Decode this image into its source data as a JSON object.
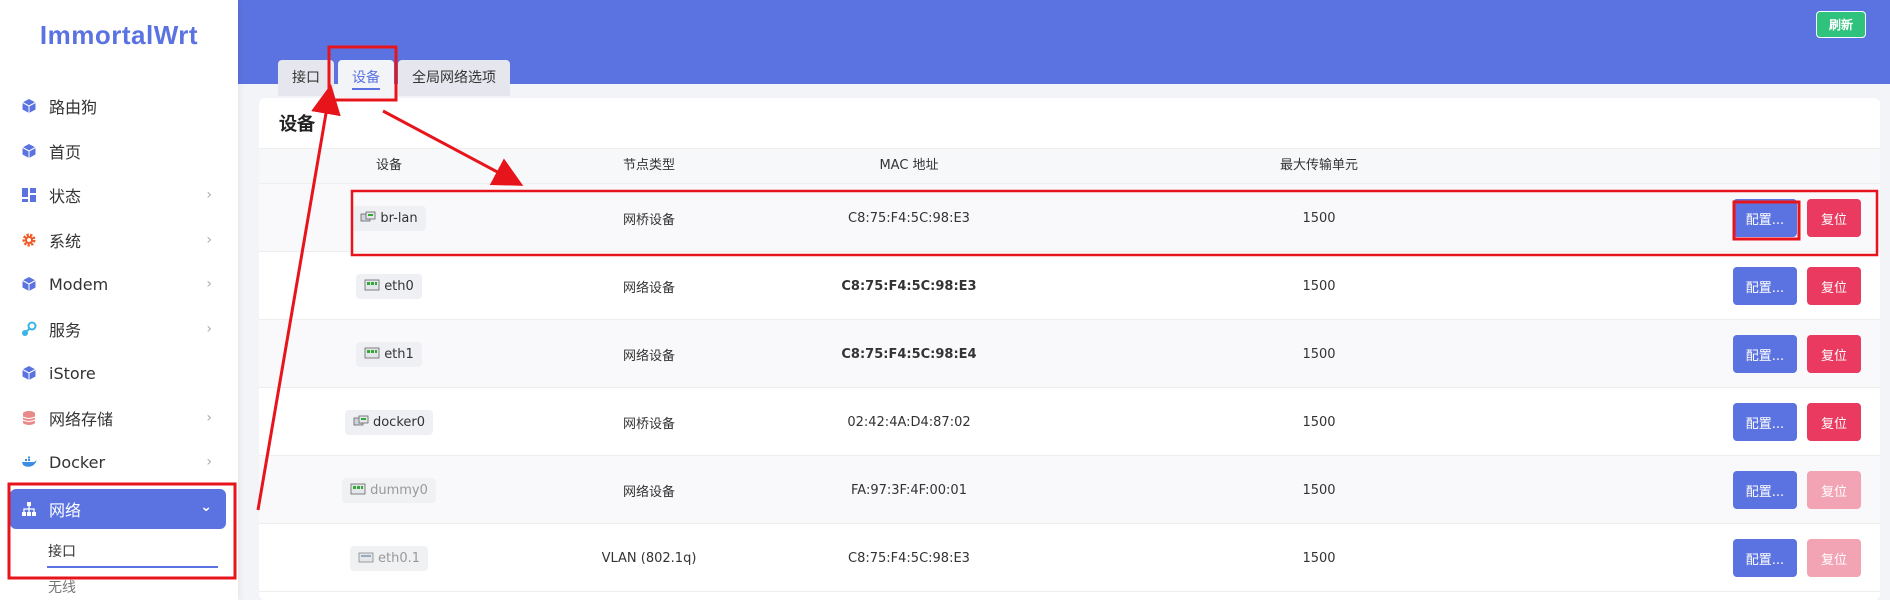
{
  "app": {
    "logo": "ImmortalWrt"
  },
  "sidebar": {
    "items": [
      {
        "label": "路由狗",
        "icon": "cube-icon",
        "chevron": false
      },
      {
        "label": "首页",
        "icon": "cube-icon",
        "chevron": false
      },
      {
        "label": "状态",
        "icon": "dashboard-icon",
        "chevron": true
      },
      {
        "label": "系统",
        "icon": "gear-icon",
        "chevron": true
      },
      {
        "label": "Modem",
        "icon": "cube-icon",
        "chevron": true
      },
      {
        "label": "服务",
        "icon": "services-icon",
        "chevron": true
      },
      {
        "label": "iStore",
        "icon": "cube-icon",
        "chevron": false
      },
      {
        "label": "网络存储",
        "icon": "database-icon",
        "chevron": true
      },
      {
        "label": "Docker",
        "icon": "docker-icon",
        "chevron": true
      },
      {
        "label": "网络",
        "icon": "network-icon",
        "chevron": true,
        "active": true
      }
    ],
    "submenu": [
      {
        "label": "接口",
        "current": true
      },
      {
        "label": "无线",
        "current": false
      }
    ]
  },
  "header": {
    "refresh_label": "刷新"
  },
  "tabs": [
    {
      "label": "接口",
      "active": false
    },
    {
      "label": "设备",
      "active": true
    },
    {
      "label": "全局网络选项",
      "active": false
    }
  ],
  "card": {
    "title": "设备",
    "columns": {
      "device": "设备",
      "type": "节点类型",
      "mac": "MAC 地址",
      "mtu": "最大传输单元"
    },
    "config_label": "配置...",
    "reset_label": "复位",
    "rows": [
      {
        "device": "br-lan",
        "type": "网桥设备",
        "mac": "C8:75:F4:5C:98:E3",
        "mtu": "1500",
        "icon": "bridge-icon",
        "dim": false,
        "mac_bold": false,
        "reset_enabled": true
      },
      {
        "device": "eth0",
        "type": "网络设备",
        "mac": "C8:75:F4:5C:98:E3",
        "mtu": "1500",
        "icon": "ethernet-icon",
        "dim": false,
        "mac_bold": true,
        "reset_enabled": true
      },
      {
        "device": "eth1",
        "type": "网络设备",
        "mac": "C8:75:F4:5C:98:E4",
        "mtu": "1500",
        "icon": "ethernet-icon",
        "dim": false,
        "mac_bold": true,
        "reset_enabled": true
      },
      {
        "device": "docker0",
        "type": "网桥设备",
        "mac": "02:42:4A:D4:87:02",
        "mtu": "1500",
        "icon": "bridge-icon",
        "dim": false,
        "mac_bold": false,
        "reset_enabled": true
      },
      {
        "device": "dummy0",
        "type": "网络设备",
        "mac": "FA:97:3F:4F:00:01",
        "mtu": "1500",
        "icon": "ethernet-icon",
        "dim": true,
        "mac_bold": false,
        "reset_enabled": false
      },
      {
        "device": "eth0.1",
        "type": "VLAN (802.1q)",
        "mac": "C8:75:F4:5C:98:E3",
        "mtu": "1500",
        "icon": "vlan-icon",
        "dim": true,
        "mac_bold": false,
        "reset_enabled": false
      }
    ]
  },
  "colors": {
    "primary": "#5b73e0",
    "success": "#2fc27c",
    "danger": "#ea3a5f",
    "annotation": "#e8141c"
  }
}
